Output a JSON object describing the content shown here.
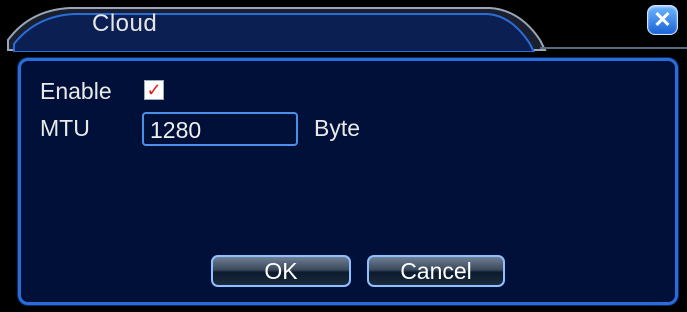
{
  "window": {
    "title": "Cloud"
  },
  "form": {
    "enable_label": "Enable",
    "enable_checked": true,
    "mtu_label": "MTU",
    "mtu_value": "1280",
    "mtu_unit": "Byte"
  },
  "buttons": {
    "ok_label": "OK",
    "cancel_label": "Cancel"
  },
  "icons": {
    "close": "close-icon",
    "check": "checkmark-icon"
  },
  "colors": {
    "panel_background": "#001038",
    "panel_border": "#2a6cd8",
    "title_bar": "#0c1f52",
    "text": "#e9e9e9",
    "checkmark": "#e02020"
  }
}
